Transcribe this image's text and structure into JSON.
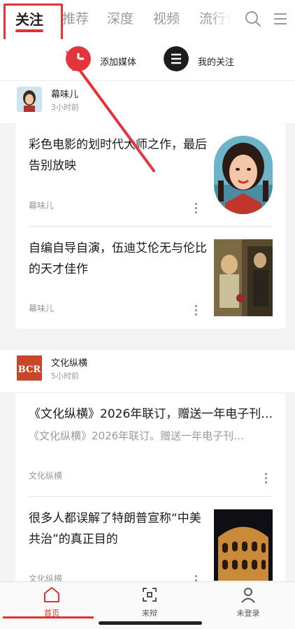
{
  "tabs": [
    "关注",
    "推荐",
    "深度",
    "视频",
    "流行色"
  ],
  "actions": {
    "add_media": "添加媒体",
    "my_follow": "我的关注"
  },
  "sections": [
    {
      "author": "幕味儿",
      "time": "3小时前",
      "items": [
        {
          "title": "彩色电影的划时代大师之作，最后告别放映",
          "source": "幕味儿"
        },
        {
          "title": "自编自导自演，伍迪艾伦无与伦比的天才佳作",
          "source": "幕味儿"
        }
      ]
    },
    {
      "author": "文化纵横",
      "avatar_text": "BCR",
      "time": "5小时前",
      "items": [
        {
          "title": "《文化纵横》2026年联订，赠送一年电子刊…",
          "subtitle": "《文化纵横》2026年联订。赠送一年电子刊…",
          "source": "文化纵横"
        },
        {
          "title": "很多人都误解了特朗普宣称“中美共治”的真正目的",
          "source": "文化纵横"
        }
      ]
    }
  ],
  "bottom_nav": [
    {
      "label": "首页",
      "icon": "home-icon",
      "active": true
    },
    {
      "label": "来辩",
      "icon": "scan-icon",
      "active": false
    },
    {
      "label": "未登录",
      "icon": "user-icon",
      "active": false
    }
  ],
  "colors": {
    "accent": "#d33333",
    "annotation": "#e5333b"
  }
}
